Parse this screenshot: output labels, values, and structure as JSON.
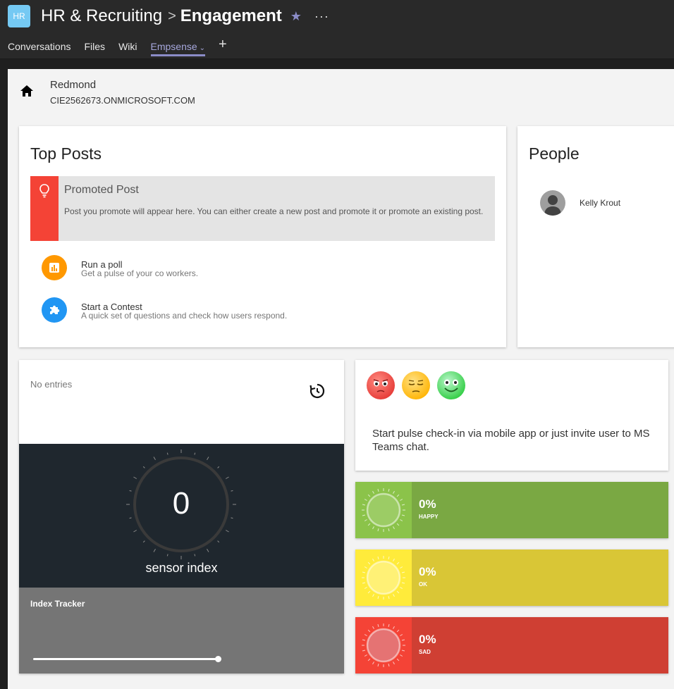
{
  "header": {
    "team_initials": "HR",
    "team_name": "HR & Recruiting",
    "separator": ">",
    "channel_name": "Engagement",
    "more": "···"
  },
  "tabs": [
    {
      "label": "Conversations",
      "active": false
    },
    {
      "label": "Files",
      "active": false
    },
    {
      "label": "Wiki",
      "active": false
    },
    {
      "label": "Empsense",
      "active": true
    }
  ],
  "add_tab": "+",
  "location": {
    "name": "Redmond",
    "domain": "CIE2562673.ONMICROSOFT.COM"
  },
  "top_posts": {
    "title": "Top Posts",
    "promoted": {
      "title": "Promoted Post",
      "description": "Post you promote will appear here. You can either create a new post and promote it or promote an existing post."
    },
    "actions": [
      {
        "title": "Run a poll",
        "subtitle": "Get a pulse of your co workers.",
        "icon": "bar-chart-icon",
        "color": "#ff9800"
      },
      {
        "title": "Start a Contest",
        "subtitle": "A quick set of questions and check how users respond.",
        "icon": "puzzle-icon",
        "color": "#2196f3"
      }
    ]
  },
  "people": {
    "title": "People",
    "items": [
      {
        "name": "Kelly Krout"
      }
    ]
  },
  "sensor": {
    "no_entries": "No entries",
    "value": "0",
    "label": "sensor index",
    "tracker_title": "Index Tracker"
  },
  "pulse": {
    "text": "Start pulse check-in via mobile app or just invite user to MS Teams chat.",
    "emojis": [
      "angry-face-icon",
      "neutral-face-icon",
      "happy-face-icon"
    ]
  },
  "moods": [
    {
      "percent": "0%",
      "label": "HAPPY",
      "color_left": "#8bc34a",
      "color_right": "#7aa843",
      "sun_color": "#9ccc65"
    },
    {
      "percent": "0%",
      "label": "OK",
      "color_left": "#ffeb3b",
      "color_right": "#d9c636",
      "sun_color": "#fff176"
    },
    {
      "percent": "0%",
      "label": "SAD",
      "color_left": "#f44336",
      "color_right": "#cf3f33",
      "sun_color": "#e57373"
    }
  ]
}
